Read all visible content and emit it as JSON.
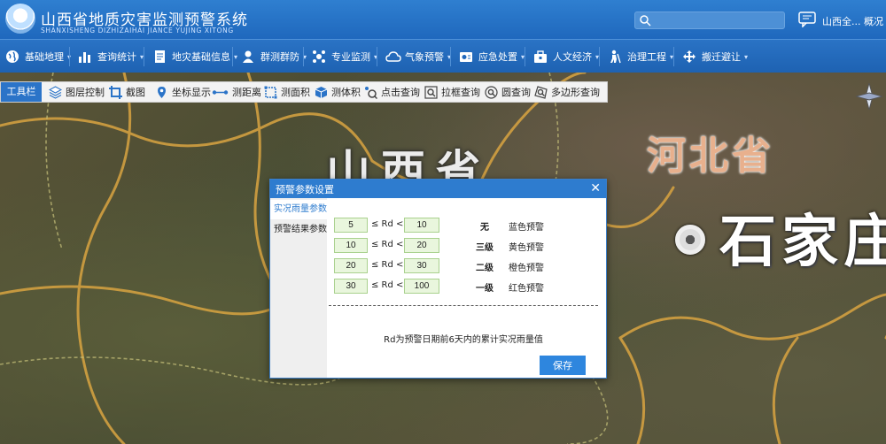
{
  "header": {
    "title": "山西省地质灾害监测预警系统",
    "subtitle": "SHANXISHENG DIZHIZAIHAI JIANCE YUJING XITONG",
    "search_placeholder": "",
    "user_name": "山西全...",
    "overview_label": "概况"
  },
  "nav": {
    "items": [
      {
        "label": "基础地理",
        "icon": "globe-icon"
      },
      {
        "label": "查询统计",
        "icon": "bar-chart-icon"
      },
      {
        "label": "地灾基础信息",
        "icon": "document-icon"
      },
      {
        "label": "群测群防",
        "icon": "person-icon"
      },
      {
        "label": "专业监测",
        "icon": "gear-network-icon"
      },
      {
        "label": "气象预警",
        "icon": "weather-icon"
      },
      {
        "label": "应急处置",
        "icon": "emergency-icon"
      },
      {
        "label": "人文经济",
        "icon": "briefcase-icon"
      },
      {
        "label": "治理工程",
        "icon": "worker-icon"
      },
      {
        "label": "搬迁避让",
        "icon": "move-icon"
      }
    ]
  },
  "toolbar": {
    "title": "工具栏",
    "tools": [
      {
        "label": "图层控制",
        "icon": "layers-icon"
      },
      {
        "label": "截图",
        "icon": "crop-icon"
      },
      {
        "label": "坐标显示",
        "icon": "pin-icon"
      },
      {
        "label": "测距离",
        "icon": "measure-distance-icon"
      },
      {
        "label": "测面积",
        "icon": "measure-area-icon"
      },
      {
        "label": "测体积",
        "icon": "cube-icon"
      },
      {
        "label": "点击查询",
        "icon": "point-query-icon"
      },
      {
        "label": "拉框查询",
        "icon": "box-query-icon"
      },
      {
        "label": "圆查询",
        "icon": "circle-query-icon"
      },
      {
        "label": "多边形查询",
        "icon": "polygon-query-icon"
      }
    ]
  },
  "map": {
    "labels": {
      "province_shanxi": "山西省",
      "province_hebei": "河北省",
      "city": "石家庄"
    }
  },
  "dialog": {
    "title": "预警参数设置",
    "close_label": "✕",
    "tabs": [
      {
        "label": "实况雨量参数",
        "active": true
      },
      {
        "label": "预警结果参数",
        "active": false
      }
    ],
    "formula": "≤ Rd <",
    "rows": [
      {
        "min": "5",
        "max": "10",
        "level": "无",
        "alert": "蓝色预警"
      },
      {
        "min": "10",
        "max": "20",
        "level": "三级",
        "alert": "黄色预警"
      },
      {
        "min": "20",
        "max": "30",
        "level": "二级",
        "alert": "橙色预警"
      },
      {
        "min": "30",
        "max": "100",
        "level": "一级",
        "alert": "红色预警"
      }
    ],
    "note": "Rd为预警日期前6天内的累计实况雨量值",
    "save_label": "保存"
  },
  "colors": {
    "primary": "#2e7ccf",
    "header_bg": "#1f68bd",
    "input_bg": "#e9f6dd",
    "input_border": "#a9d18e"
  }
}
